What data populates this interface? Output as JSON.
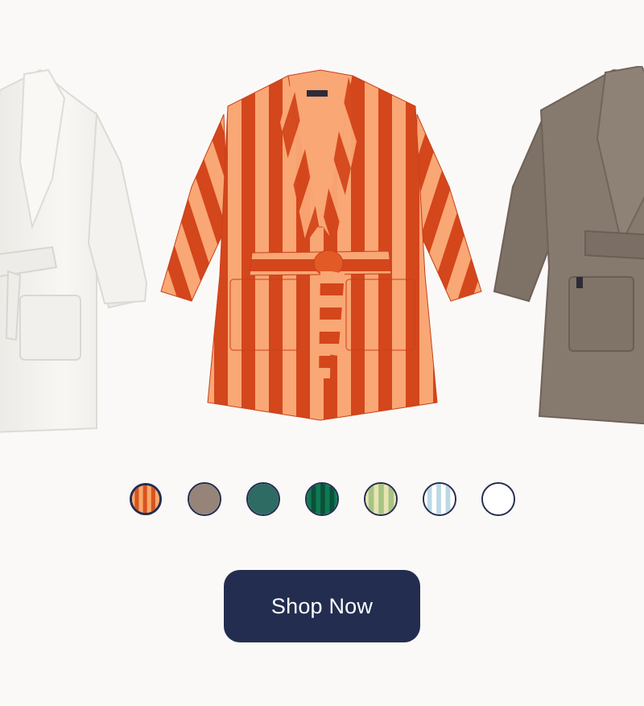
{
  "cta": {
    "label": "Shop Now"
  },
  "colors": {
    "background": "#fbf9f7",
    "button": "#232d4f",
    "button_text": "#ffffff"
  },
  "products": [
    {
      "name": "white-robe",
      "color": "#f4f3ef"
    },
    {
      "name": "striped-robe",
      "colors": [
        "#d5471a",
        "#f9b07a"
      ]
    },
    {
      "name": "taupe-robe",
      "color": "#86796e"
    }
  ],
  "swatches": [
    {
      "name": "orange-stripe",
      "selected": true,
      "colors": [
        "#d9531e",
        "#f7a86a"
      ]
    },
    {
      "name": "taupe",
      "selected": false,
      "colors": [
        "#968478"
      ]
    },
    {
      "name": "dark-teal",
      "selected": false,
      "colors": [
        "#2e6b63"
      ]
    },
    {
      "name": "green-stripe",
      "selected": false,
      "colors": [
        "#0d7a52",
        "#0b4f3a"
      ]
    },
    {
      "name": "sage-stripe",
      "selected": false,
      "colors": [
        "#a7c484",
        "#e9e3b2"
      ]
    },
    {
      "name": "light-blue-stripe",
      "selected": false,
      "colors": [
        "#bcd8e6",
        "#ffffff"
      ]
    },
    {
      "name": "white",
      "selected": false,
      "colors": [
        "#ffffff"
      ]
    }
  ]
}
